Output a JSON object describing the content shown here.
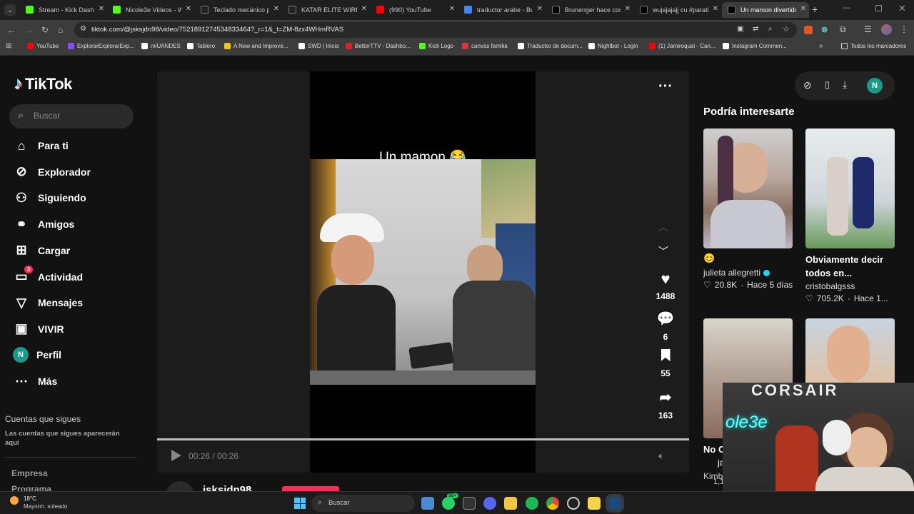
{
  "browser": {
    "tabs": [
      {
        "label": "Stream - Kick Dashbo",
        "color": "#53fc18"
      },
      {
        "label": "Nicole3e Videos - Wa",
        "color": "#53fc18"
      },
      {
        "label": "Teclado mecánico pa",
        "color": "#222"
      },
      {
        "label": "KATAR ELITE WIRELES",
        "color": "#222"
      },
      {
        "label": "(990) YouTube",
        "color": "#ff0000"
      },
      {
        "label": "traductor arabe - Bus",
        "color": "#4285f4"
      },
      {
        "label": "Brunenger hace coro",
        "color": "#000"
      },
      {
        "label": "wujajajajj cu #parati",
        "color": "#000"
      },
      {
        "label": "Un mamon divertido",
        "color": "#000"
      }
    ],
    "url": "tiktok.com/@jsksjdn98/video/7521891274534833464?_r=1&_t=ZM-8zx4WHmRVAS",
    "bookmarks": [
      {
        "label": "YouTube",
        "color": "#ff0000"
      },
      {
        "label": "ExplorarExplorarExp...",
        "color": "#8a4bff"
      },
      {
        "label": "miUANDES",
        "color": "#ffffff"
      },
      {
        "label": "Tablero",
        "color": "#ffffff"
      },
      {
        "label": "A New and Improve...",
        "color": "#f5c518"
      },
      {
        "label": "SWD | Inicio",
        "color": "#ffffff"
      },
      {
        "label": "BetterTTV - Dashbo...",
        "color": "#d22"
      },
      {
        "label": "Kick Logo",
        "color": "#53fc18"
      },
      {
        "label": "canvas familia",
        "color": "#d33"
      },
      {
        "label": "Traductor de docum...",
        "color": "#ffffff"
      },
      {
        "label": "Nightbot - Login",
        "color": "#ffffff"
      },
      {
        "label": "(1) Jamiroquai - Can...",
        "color": "#ff0000"
      },
      {
        "label": "Instagram Commen...",
        "color": "#ffffff"
      }
    ],
    "all_bookmarks": "Todos los marcadores"
  },
  "tiktok": {
    "logo": "TikTok",
    "search_placeholder": "Buscar",
    "nav": [
      {
        "label": "Para ti",
        "icon": "home-icon"
      },
      {
        "label": "Explorador",
        "icon": "compass-icon"
      },
      {
        "label": "Siguiendo",
        "icon": "following-icon"
      },
      {
        "label": "Amigos",
        "icon": "friends-icon"
      },
      {
        "label": "Cargar",
        "icon": "upload-icon"
      },
      {
        "label": "Actividad",
        "icon": "inbox-icon"
      },
      {
        "label": "Mensajes",
        "icon": "messages-icon"
      },
      {
        "label": "VIVIR",
        "icon": "live-icon"
      },
      {
        "label": "Perfil",
        "icon": "profile-icon"
      },
      {
        "label": "Más",
        "icon": "more-icon"
      }
    ],
    "activity_badge": "3",
    "profile_initial": "N",
    "following_title": "Cuentas que sigues",
    "following_desc": "Las cuentas que sigues aparecerán aquí",
    "footer": [
      "Empresa",
      "Programa"
    ],
    "video": {
      "caption": "Un mamon 😂",
      "time": "00:26 / 00:26",
      "progress": 1.0,
      "likes": "1488",
      "comments": "6",
      "saves": "55",
      "shares": "163",
      "author": "jsksjdn98"
    },
    "recommend": {
      "title": "Podría interesarte",
      "cards": [
        {
          "desc": "😊",
          "author": "julieta allegretti",
          "likes": "20.8K",
          "time": "Hace 5 días"
        },
        {
          "desc": "Obviamente decir todos en...",
          "author": "cristobalgsss",
          "likes": "705.2K",
          "time": "Hace 1..."
        }
      ],
      "partial": [
        "No C",
        "ja",
        "Kimb",
        "1,1"
      ]
    },
    "overlay_brand": "CORSAIR",
    "overlay_name": "ole3e"
  },
  "taskbar": {
    "weather_temp": "18°C",
    "weather_desc": "Mayorm. soleado",
    "search": "Buscar",
    "badge": "99+"
  }
}
